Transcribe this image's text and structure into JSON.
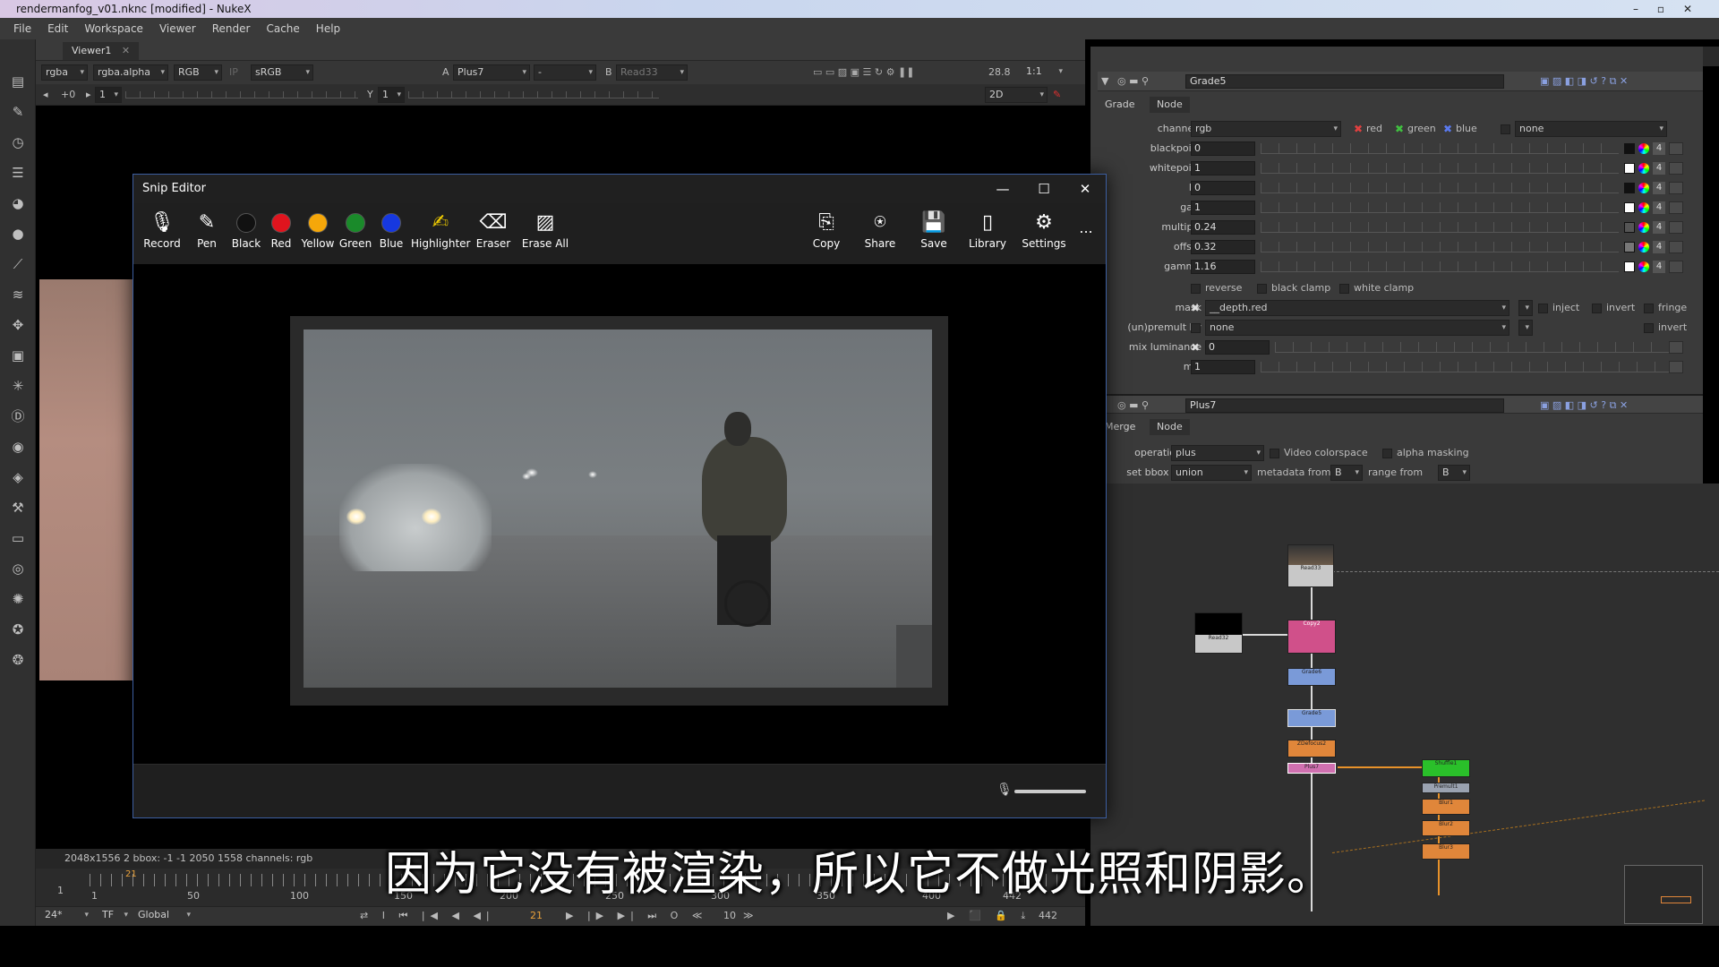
{
  "window": {
    "title": "rendermanfog_v01.nknc [modified] - NukeX",
    "min": "–",
    "max": "▫",
    "close": "✕"
  },
  "menu": [
    "File",
    "Edit",
    "Workspace",
    "Viewer",
    "Render",
    "Cache",
    "Help"
  ],
  "viewer": {
    "tab": "Viewer1",
    "tab_close": "✕",
    "channels": "rgba",
    "alpha": "rgba.alpha",
    "colorspace_rgb": "RGB",
    "ip": "IP",
    "lut": "sRGB",
    "input_a_label": "A",
    "input_a": "Plus7",
    "input_mid": "-",
    "input_b_label": "B",
    "input_b": "Read33",
    "zoom_fps": "28.8",
    "ratio": "1:1",
    "gain_label": "+0",
    "frame_field": "1",
    "gamma_label": "Y",
    "gamma_field": "1",
    "view_mode": "2D",
    "info": "2048x1556 2  bbox: -1 -1 2050 1558 channels: rgb"
  },
  "timeline": {
    "ticks": [
      "1",
      "50",
      "100",
      "150",
      "200",
      "250",
      "300",
      "350",
      "400",
      "442"
    ],
    "start": "1",
    "current_marker": "21",
    "fps": "24*",
    "tf": "TF",
    "global": "Global",
    "current_frame": "21",
    "step": "10",
    "end_frame": "442"
  },
  "properties": {
    "bin_count": "3",
    "grade": {
      "node_name": "Grade5",
      "tabs": [
        "Grade",
        "Node"
      ],
      "channels_label": "channels",
      "channels_value": "rgb",
      "red": "red",
      "green": "green",
      "blue": "blue",
      "none": "none",
      "rows": [
        {
          "label": "blackpoint",
          "value": "0"
        },
        {
          "label": "whitepoint",
          "value": "1"
        },
        {
          "label": "lift",
          "value": "0"
        },
        {
          "label": "gain",
          "value": "1"
        },
        {
          "label": "multiply",
          "value": "0.24"
        },
        {
          "label": "offset",
          "value": "0.32"
        },
        {
          "label": "gamma",
          "value": "1.16"
        }
      ],
      "reverse": "reverse",
      "black_clamp": "black clamp",
      "white_clamp": "white clamp",
      "mask_label": "mask",
      "mask_value": "__depth.red",
      "inject": "inject",
      "invert": "invert",
      "fringe": "fringe",
      "unpremult_label": "(un)premult by",
      "unpremult_value": "none",
      "mix_luminance_label": "mix luminance",
      "mix_luminance_value": "0",
      "mix_label": "mix",
      "mix_value": "1",
      "swatch_num": "4"
    },
    "plus": {
      "node_name": "Plus7",
      "tabs": [
        "Merge",
        "Node"
      ],
      "operation_label": "operation",
      "operation_value": "plus",
      "video_colorspace": "Video colorspace",
      "alpha_masking": "alpha masking",
      "bbox_label": "set bbox to",
      "bbox_value": "union",
      "metadata_label": "metadata from",
      "metadata_value": "B",
      "range_label": "range from",
      "range_value": "B"
    }
  },
  "nodes": {
    "read33": "Read33",
    "read32": "Read32",
    "copy2": "Copy2",
    "grade6": "Grade6",
    "grade5": "Grade5",
    "zdefocus": "ZDefocus2",
    "plus": "Plus7",
    "shuffle": "Shuffle1",
    "premult": "Premult1",
    "blur1": "Blur1",
    "blur2": "Blur2",
    "blur3": "Blur3"
  },
  "snip": {
    "title": "Snip Editor",
    "tools": [
      "Record",
      "Pen",
      "Black",
      "Red",
      "Yellow",
      "Green",
      "Blue",
      "Highlighter",
      "Eraser",
      "Erase All"
    ],
    "actions": [
      "Copy",
      "Share",
      "Save",
      "Library",
      "Settings"
    ],
    "more": "...",
    "colors": {
      "black": "#111111",
      "red": "#e0141e",
      "yellow": "#f5a70a",
      "green": "#1a8a2a",
      "blue": "#1638e0"
    }
  },
  "subtitle": "因为它没有被渲染，所以它不做光照和阴影。"
}
